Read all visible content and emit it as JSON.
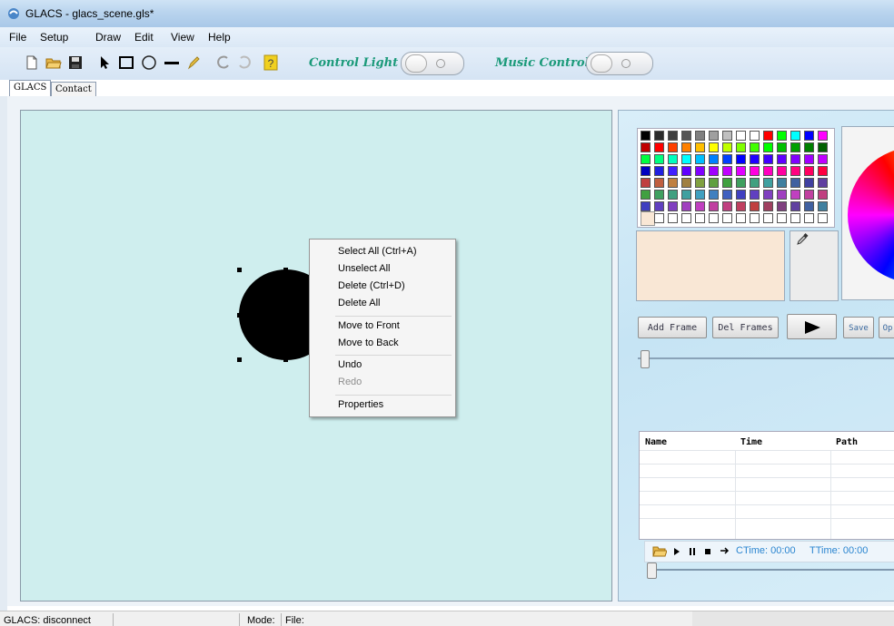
{
  "window": {
    "title": "GLACS - glacs_scene.gls*"
  },
  "menu": [
    "File",
    "Setup",
    "Draw",
    "Edit",
    "View",
    "Help"
  ],
  "toolbar": {
    "control_light_label": "Control Light",
    "music_control_label": "Music Control",
    "icons": [
      "new-file-icon",
      "open-folder-icon",
      "save-icon",
      "pointer-icon",
      "rectangle-icon",
      "ellipse-icon",
      "line-icon",
      "pencil-icon",
      "undo-icon",
      "redo-icon",
      "help-icon"
    ]
  },
  "tabs": [
    {
      "label": "GLACS",
      "active": true
    },
    {
      "label": "Contact",
      "active": false
    }
  ],
  "context_menu": {
    "items": [
      {
        "label": "Select All  (Ctrl+A)",
        "enabled": true
      },
      {
        "label": "Unselect All",
        "enabled": true
      },
      {
        "label": "Delete (Ctrl+D)",
        "enabled": true
      },
      {
        "label": "Delete All",
        "enabled": true
      },
      {
        "label": "Move to Front",
        "enabled": true
      },
      {
        "label": "Move to Back",
        "enabled": true
      },
      {
        "label": "Undo",
        "enabled": true
      },
      {
        "label": "Redo",
        "enabled": false
      },
      {
        "label": "Properties",
        "enabled": true
      }
    ]
  },
  "palette_colors": [
    [
      "#000000",
      "#2b2b2b",
      "#3f3f3f",
      "#555555",
      "#7f7f7f",
      "#9f9f9f",
      "#bfbfbf",
      "#ffffff",
      "#ffffff",
      "#ff0000",
      "#00ff00",
      "#00ffff",
      "#0000ff",
      "#ff00ff"
    ],
    [
      "#c00000",
      "#ff0000",
      "#ff4000",
      "#ff8000",
      "#ffbf00",
      "#ffff00",
      "#bfff00",
      "#80ff00",
      "#40ff00",
      "#00ff00",
      "#00c000",
      "#00a000",
      "#008000",
      "#006000"
    ],
    [
      "#00ff40",
      "#00ff80",
      "#00ffbf",
      "#00ffff",
      "#00bfff",
      "#0080ff",
      "#0040ff",
      "#0000ff",
      "#2000ff",
      "#4000ff",
      "#6000ff",
      "#8000ff",
      "#a000ff",
      "#c000ff"
    ],
    [
      "#0000c0",
      "#2020e0",
      "#4020ff",
      "#6000ff",
      "#8000ff",
      "#a000ff",
      "#c000ff",
      "#e000ff",
      "#ff00e0",
      "#ff00c0",
      "#ff00a0",
      "#ff0080",
      "#ff0060",
      "#ff0040"
    ],
    [
      "#c04040",
      "#c06040",
      "#c08040",
      "#a08040",
      "#80a040",
      "#60a040",
      "#40a040",
      "#40a060",
      "#40a080",
      "#40a0a0",
      "#4080a0",
      "#4060a0",
      "#4040a0",
      "#6040a0"
    ],
    [
      "#40a040",
      "#40a060",
      "#40a080",
      "#40a0a0",
      "#40a0c0",
      "#4080c0",
      "#4060c0",
      "#4040c0",
      "#6040c0",
      "#8040c0",
      "#a040c0",
      "#c040c0",
      "#c040a0",
      "#c04080"
    ],
    [
      "#4040c0",
      "#6040c0",
      "#8040c0",
      "#a040c0",
      "#c040c0",
      "#c040a0",
      "#c04080",
      "#c04060",
      "#c04040",
      "#a04060",
      "#804080",
      "#6040a0",
      "#4060a0",
      "#4080a0"
    ],
    [
      "#f9e7d5",
      "#ffffff",
      "#ffffff",
      "#ffffff",
      "#ffffff",
      "#ffffff",
      "#ffffff",
      "#ffffff",
      "#ffffff",
      "#ffffff",
      "#ffffff",
      "#ffffff",
      "#ffffff",
      "#ffffff"
    ]
  ],
  "selected_color": "#f9e7d5",
  "buttons": {
    "add_frame": "Add Frame",
    "del_frames": "Del Frames",
    "save": "Save",
    "open_partial": "Op"
  },
  "table": {
    "headers": [
      "Name",
      "Time",
      "Path"
    ]
  },
  "media": {
    "ctime_label": "CTime: 00:00",
    "ttime_label": "TTime: 00:00"
  },
  "status": {
    "connection": "GLACS: disconnect",
    "mode": "Mode:",
    "file": "File:"
  },
  "colors": {
    "canvas_bg": "#cfeeee",
    "accent_text": "#1b9a7a",
    "media_text": "#2a85d0"
  }
}
